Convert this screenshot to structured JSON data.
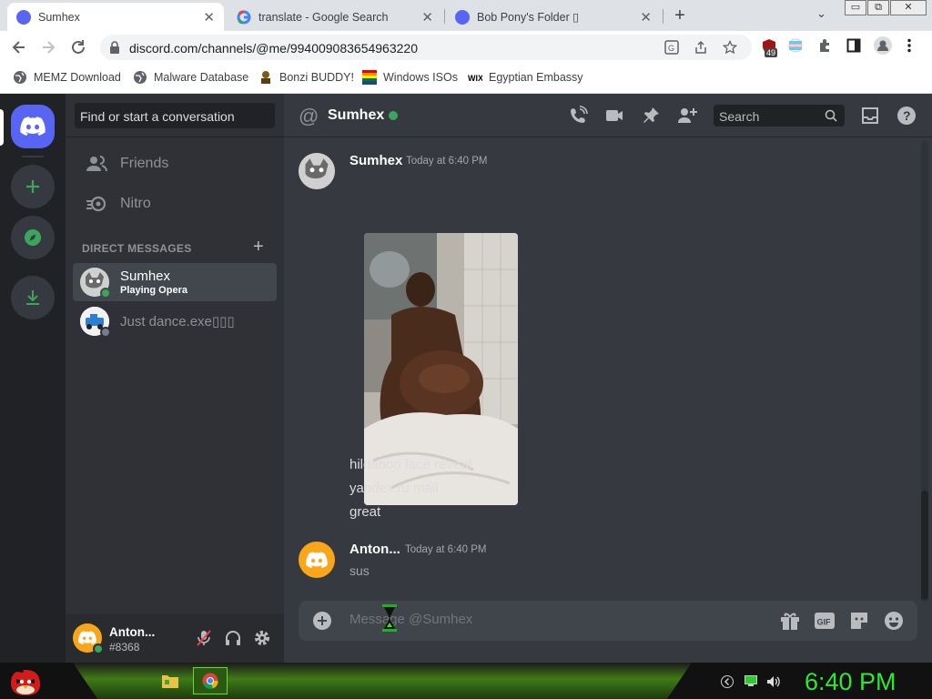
{
  "browser": {
    "tabs": [
      {
        "title": "Sumhex",
        "close": "✕",
        "active": true
      },
      {
        "title": "translate - Google Search",
        "close": "✕",
        "active": false
      },
      {
        "title": "Bob Pony's Folder ▯",
        "close": "✕",
        "active": false
      }
    ],
    "new_tab": "+",
    "tab_search": "⌄",
    "window_controls": {
      "minimize": "▭",
      "restore": "⧉",
      "close": "✕"
    },
    "url": "discord.com/channels/@me/994009083654963220",
    "extension_badge": "49",
    "bookmarks": [
      {
        "label": "MEMZ Download",
        "icon": "globe-icon"
      },
      {
        "label": "Malware Database",
        "icon": "globe-icon"
      },
      {
        "label": "Bonzi BUDDY!",
        "icon": "bonzi-icon"
      },
      {
        "label": "Windows ISOs",
        "icon": "windows-flag-icon"
      },
      {
        "label": "Egyptian Embassy",
        "icon": "wix-icon"
      }
    ]
  },
  "discord": {
    "search_placeholder": "Find or start a conversation",
    "nav": [
      {
        "label": "Friends",
        "icon": "friends-icon"
      },
      {
        "label": "Nitro",
        "icon": "nitro-icon"
      }
    ],
    "dm_header": "DIRECT MESSAGES",
    "dm_add": "+",
    "dms": [
      {
        "name": "Sumhex",
        "status": "Playing Opera",
        "presence": "online",
        "selected": true
      },
      {
        "name": "Just dance.exe▯▯▯",
        "status": "",
        "presence": "offline",
        "selected": false
      }
    ],
    "user": {
      "name": "Anton...",
      "tag": "#8368",
      "presence": "online"
    },
    "channel": {
      "at": "@",
      "name": "Sumhex",
      "search_placeholder": "Search"
    },
    "messages": [
      {
        "author": "Sumhex",
        "timestamp": "Today at 6:40 PM",
        "attachment": "image",
        "lines": [
          "hildaboo face reveal",
          "yandex.ru mail",
          "great"
        ]
      },
      {
        "author": "Anton...",
        "timestamp": "Today at 6:40 PM",
        "lines": [
          "sus"
        ]
      }
    ],
    "composer_placeholder": "Message @Sumhex",
    "composer_icons": [
      "gift-icon",
      "gif-icon",
      "sticker-icon",
      "emoji-icon"
    ],
    "colors": {
      "blurple": "#5865f2",
      "online": "#3ba55d",
      "bg_main": "#36393f",
      "bg_sidebar": "#2f3136",
      "bg_guilds": "#202225"
    }
  },
  "taskbar": {
    "clock": "6:40 PM",
    "apps": [
      "folder-icon",
      "chrome-icon"
    ]
  }
}
